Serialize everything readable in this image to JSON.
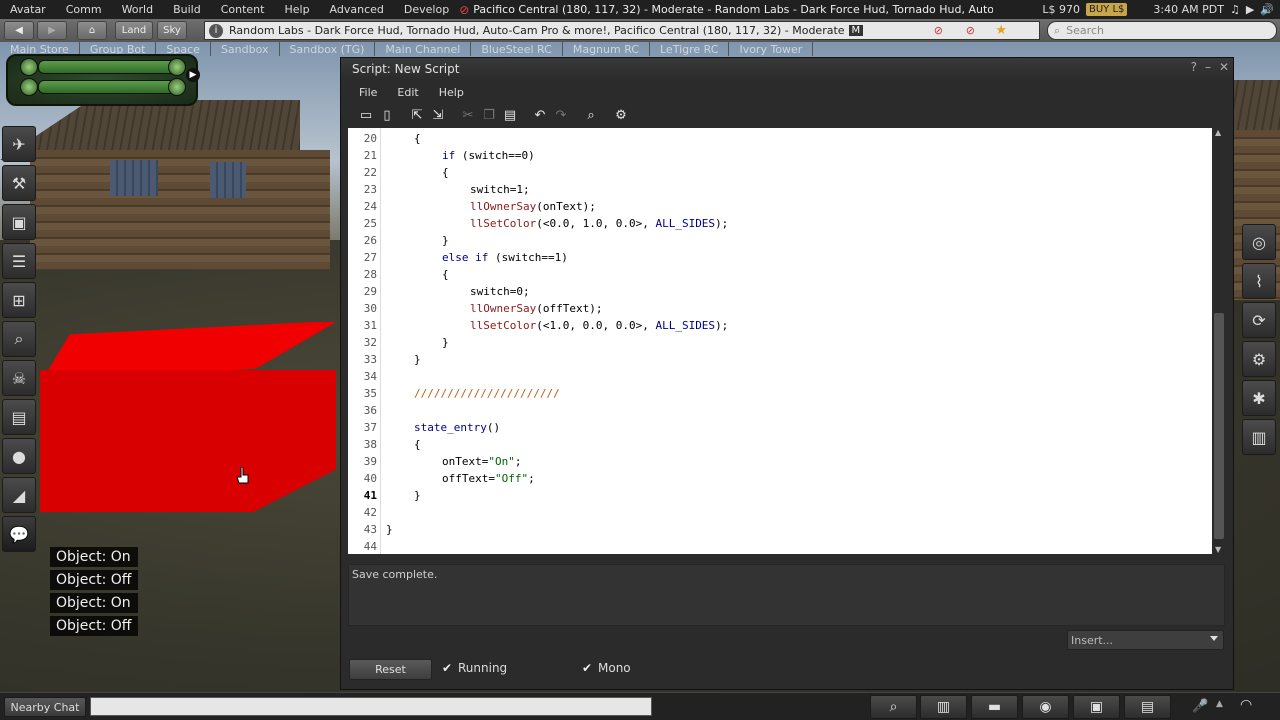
{
  "menubar": {
    "items": [
      "Avatar",
      "Comm",
      "World",
      "Build",
      "Content",
      "Help",
      "Advanced",
      "Develop"
    ],
    "location_text": "Pacifico Central (180, 117, 32) - Moderate - Random Labs - Dark Force Hud, Tornado Hud, Auto-",
    "balance": "L$ 970",
    "buy_label": "BUY L$",
    "time": "3:40 AM PDT"
  },
  "navbar": {
    "land_label": "Land",
    "sky_label": "Sky",
    "location_field": "Random Labs - Dark Force Hud, Tornado Hud, Auto-Cam Pro & more!, Pacifico Central (180, 117, 32) - Moderate",
    "rating_badge": "M",
    "search_placeholder": "Search"
  },
  "favorites": [
    "Main Store",
    "Group Bot",
    "Space",
    "Sandbox",
    "Sandbox (TG)",
    "Main Channel",
    "BlueSteel RC",
    "Magnum RC",
    "LeTigre RC",
    "Ivory Tower"
  ],
  "chat_lines": [
    "Object: On",
    "Object: Off",
    "Object: On",
    "Object: Off"
  ],
  "script_window": {
    "title": "Script: New Script",
    "menu": [
      "File",
      "Edit",
      "Help"
    ],
    "status": "Save complete.",
    "insert_label": "Insert...",
    "reset_label": "Reset",
    "running_label": "Running",
    "running_checked": true,
    "mono_label": "Mono",
    "mono_checked": true,
    "current_line": 41,
    "code_lines": [
      {
        "n": 20,
        "indent": 1,
        "html": "{"
      },
      {
        "n": 21,
        "indent": 2,
        "html": "<span class='kw'>if</span> (switch==0)"
      },
      {
        "n": 22,
        "indent": 2,
        "html": "{"
      },
      {
        "n": 23,
        "indent": 3,
        "html": "switch=1;"
      },
      {
        "n": 24,
        "indent": 3,
        "html": "<span class='fn'>llOwnerSay</span>(onText);"
      },
      {
        "n": 25,
        "indent": 3,
        "html": "<span class='fn'>llSetColor</span>(&lt;0.0, 1.0, 0.0&gt;, <span class='const'>ALL_SIDES</span>);"
      },
      {
        "n": 26,
        "indent": 2,
        "html": "}"
      },
      {
        "n": 27,
        "indent": 2,
        "html": "<span class='kw'>else if</span> (switch==1)"
      },
      {
        "n": 28,
        "indent": 2,
        "html": "{"
      },
      {
        "n": 29,
        "indent": 3,
        "html": "switch=0;"
      },
      {
        "n": 30,
        "indent": 3,
        "html": "<span class='fn'>llOwnerSay</span>(offText);"
      },
      {
        "n": 31,
        "indent": 3,
        "html": "<span class='fn'>llSetColor</span>(&lt;1.0, 0.0, 0.0&gt;, <span class='const'>ALL_SIDES</span>);"
      },
      {
        "n": 32,
        "indent": 2,
        "html": "}"
      },
      {
        "n": 33,
        "indent": 1,
        "html": "}"
      },
      {
        "n": 34,
        "indent": 0,
        "html": ""
      },
      {
        "n": 35,
        "indent": 1,
        "html": "<span class='cmt'>//////////////////////</span>"
      },
      {
        "n": 36,
        "indent": 0,
        "html": ""
      },
      {
        "n": 37,
        "indent": 1,
        "html": "<span class='ev'>state_entry</span>()"
      },
      {
        "n": 38,
        "indent": 1,
        "html": "{"
      },
      {
        "n": 39,
        "indent": 2,
        "html": "onText=<span class='str'>\"On\"</span>;"
      },
      {
        "n": 40,
        "indent": 2,
        "html": "offText=<span class='str'>\"Off\"</span>;"
      },
      {
        "n": 41,
        "indent": 1,
        "html": "}"
      },
      {
        "n": 42,
        "indent": 0,
        "html": ""
      },
      {
        "n": 43,
        "indent": 0,
        "html": "}"
      },
      {
        "n": 44,
        "indent": 0,
        "html": ""
      }
    ]
  },
  "bottombar": {
    "nearby_chat_label": "Nearby Chat"
  },
  "colors": {
    "cube": "#e00000",
    "accent_buy": "#c9a54a"
  }
}
